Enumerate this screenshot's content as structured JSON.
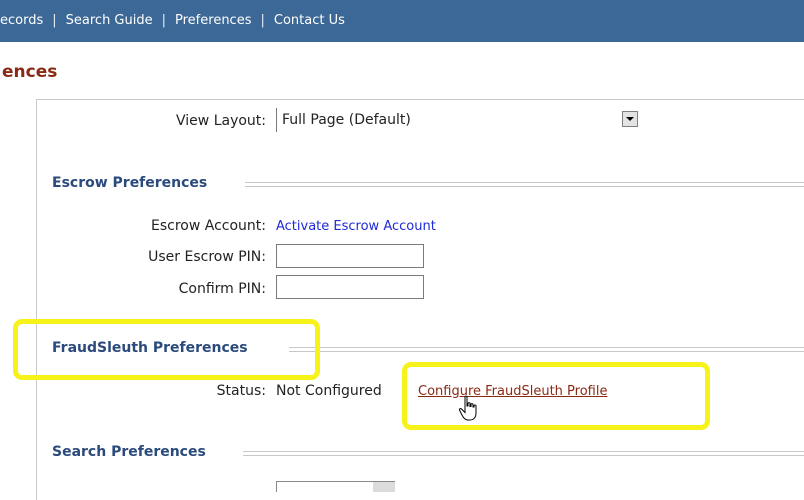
{
  "nav": {
    "items": [
      "ecords",
      "Search Guide",
      "Preferences",
      "Contact Us"
    ],
    "separator": "|"
  },
  "page": {
    "title": "ences"
  },
  "view_layout": {
    "label": "View Layout:",
    "value": "Full Page (Default)"
  },
  "escrow": {
    "heading": "Escrow Preferences",
    "account_label": "Escrow Account:",
    "account_link": "Activate Escrow Account",
    "pin_label": "User Escrow PIN:",
    "confirm_label": "Confirm PIN:"
  },
  "fraud": {
    "heading": "FraudSleuth Preferences",
    "status_label": "Status:",
    "status_value": "Not Configured",
    "configure_link": "Configure FraudSleuth Profile"
  },
  "search": {
    "heading": "Search Preferences"
  },
  "colors": {
    "nav_bg": "#3c6897",
    "title": "#8a2a14",
    "section_heading": "#2b4a7c",
    "link": "#1f2ad8",
    "highlight": "#f6f21a"
  }
}
